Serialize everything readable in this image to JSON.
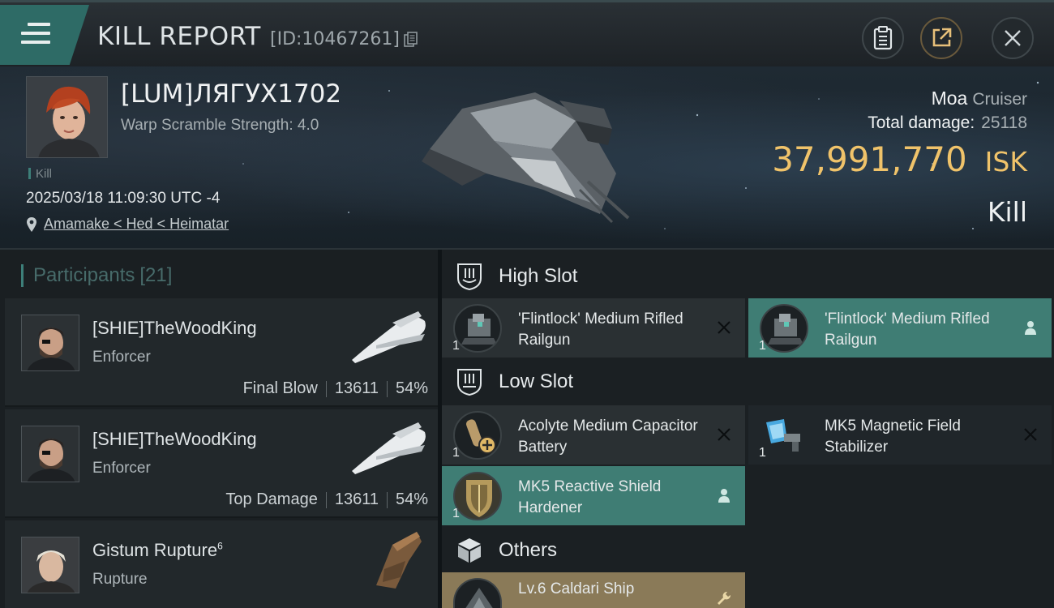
{
  "window": {
    "title": "KILL REPORT",
    "report_id": "[ID:10467261]"
  },
  "victim": {
    "name": "[LUM]ЛЯГУХ1702",
    "warp_scramble": "Warp Scramble Strength: 4.0",
    "tag": "Kill",
    "datetime": "2025/03/18 11:09:30 UTC -4",
    "location": "Amamake < Hed < Heimatar"
  },
  "ship": {
    "name": "Moa",
    "class": "Cruiser",
    "total_damage_label": "Total damage:",
    "total_damage": "25118",
    "isk_value": "37,991,770",
    "isk_unit": "ISK",
    "result": "Kill"
  },
  "participants": {
    "label": "Participants",
    "count": "[21]",
    "rows": [
      {
        "name": "[SHIE]TheWoodKing",
        "ship": "Enforcer",
        "role": "Final Blow",
        "damage": "13611",
        "percent": "54%"
      },
      {
        "name": "[SHIE]TheWoodKing",
        "ship": "Enforcer",
        "role": "Top Damage",
        "damage": "13611",
        "percent": "54%"
      },
      {
        "name": "Gistum Rupture",
        "superscript": "6",
        "ship": "Rupture"
      }
    ]
  },
  "fittings": {
    "high_slot": {
      "title": "High Slot",
      "items": [
        {
          "qty": "1",
          "name": "'Flintlock' Medium Rifled Railgun",
          "status": "destroyed",
          "status_icon": "close-icon"
        },
        {
          "qty": "1",
          "name": "'Flintlock' Medium Rifled Railgun",
          "status": "dropped",
          "status_icon": "person-icon"
        }
      ]
    },
    "low_slot": {
      "title": "Low Slot",
      "items": [
        {
          "qty": "1",
          "name": "Acolyte Medium Capacitor Battery",
          "status": "destroyed",
          "status_icon": "close-icon"
        },
        {
          "qty": "1",
          "name": "MK5 Magnetic Field Stabilizer",
          "status": "destroyed",
          "status_icon": "close-icon"
        },
        {
          "qty": "1",
          "name": "MK5 Reactive Shield Hardener",
          "status": "dropped",
          "status_icon": "person-icon"
        }
      ]
    },
    "others": {
      "title": "Others",
      "items": [
        {
          "name": "Lv.6 Caldari Ship",
          "status_icon": "wrench-icon"
        }
      ]
    }
  },
  "colors": {
    "accent_teal": "#3f7d74",
    "isk_gold": "#f0c36a",
    "other_tan": "#8a7a58"
  }
}
